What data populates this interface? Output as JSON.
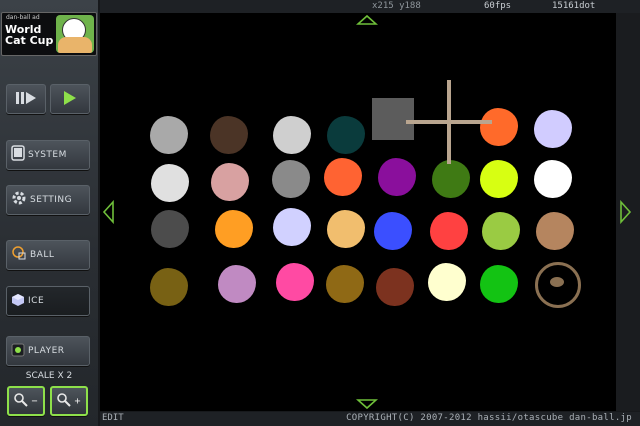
{
  "ad": {
    "small_text": "dan-ball ad",
    "title_line1": "World",
    "title_line2": "Cat Cup"
  },
  "controls": {
    "step_icon": "step-play-icon",
    "play_icon": "play-icon"
  },
  "menu": [
    {
      "label": "SYSTEM",
      "icon": "tablet-icon"
    },
    {
      "label": "SETTING",
      "icon": "gear-icon"
    },
    {
      "label": "BALL",
      "icon": "ball-icon"
    },
    {
      "label": "ICE",
      "icon": "cube-icon"
    },
    {
      "label": "PLAYER",
      "icon": "record-icon"
    }
  ],
  "scale": {
    "label": "SCALE X 2"
  },
  "zoom": {
    "out_label": "−",
    "in_label": "+"
  },
  "status": {
    "coords": "x215 y188",
    "fps": "60fps",
    "dots": "15161dot",
    "mode": "EDIT",
    "copyright": "COPYRIGHT(C) 2007-2012 hassii/otascube dan-ball.jp"
  },
  "colors": {
    "accent_green": "#8ee04a",
    "row1": [
      "#a9a9a9",
      "#4b3426",
      "#cfcfcf",
      "#0a3b3c",
      "#5c5c5c",
      "#ff6a2a",
      "#d1ccff"
    ],
    "row2": [
      "#e0e0e0",
      "#d8a1a1",
      "#8a8a8a",
      "#ff6332",
      "#8a0f9c",
      "#3f7a14",
      "#d7ff12",
      "#ffffff"
    ],
    "row3": [
      "#4c4c4c",
      "#ff9e23",
      "#d1d1ff",
      "#f1be6e",
      "#3b4fff",
      "#ff4141",
      "#9acb43",
      "#b5855f"
    ],
    "row4": [
      "#786114",
      "#c08ac2",
      "#ff4aa3",
      "#8f6915",
      "#7c321f",
      "#ffffcf",
      "#13c313",
      "#8a7052"
    ]
  }
}
